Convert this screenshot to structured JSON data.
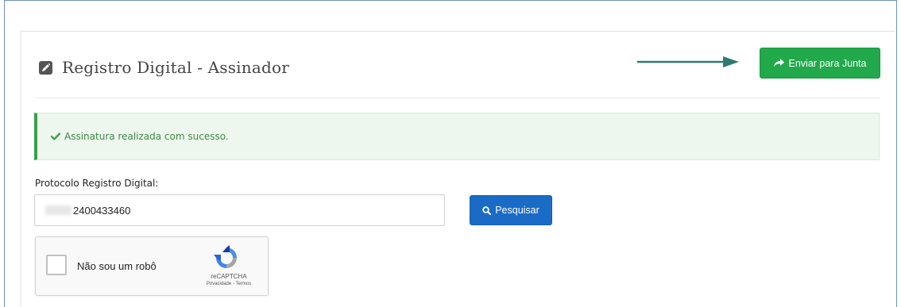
{
  "page": {
    "title": "Registro Digital - Assinador"
  },
  "toolbar": {
    "send_label": "Enviar para Junta"
  },
  "alert": {
    "message": "Assinatura realizada com sucesso."
  },
  "form": {
    "protocol_label": "Protocolo Registro Digital:",
    "protocol_value": "2400433460",
    "search_label": "Pesquisar"
  },
  "captcha": {
    "label": "Não sou um robô",
    "brand": "reCAPTCHA",
    "links": "Privacidade - Termos"
  },
  "colors": {
    "success_button": "#21a94b",
    "primary_button": "#1a6bc5",
    "alert_border": "#3aa04a",
    "alert_background": "#eef7ee",
    "arrow": "#2f7a70"
  },
  "icons": {
    "title": "edit-icon",
    "send": "share-arrow-icon",
    "alert": "check-icon",
    "search": "search-icon",
    "captcha": "recaptcha-logo-icon",
    "annotation": "arrow-right-icon"
  }
}
